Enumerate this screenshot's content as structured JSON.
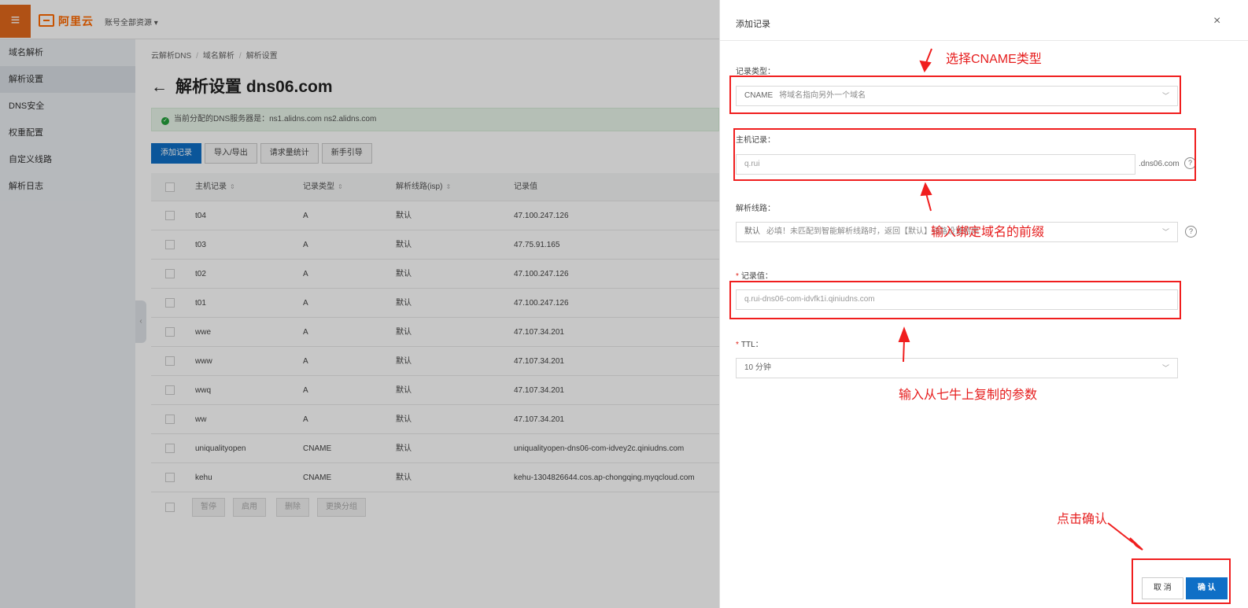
{
  "topbar": {
    "menu_icon": "≡",
    "logo_text": "阿里云",
    "account_scope": "账号全部资源 ▾"
  },
  "sidebar": {
    "items": [
      {
        "label": "域名解析",
        "active": false
      },
      {
        "label": "解析设置",
        "active": true
      },
      {
        "label": "DNS安全",
        "active": false
      },
      {
        "label": "权重配置",
        "active": false
      },
      {
        "label": "自定义线路",
        "active": false
      },
      {
        "label": "解析日志",
        "active": false
      }
    ],
    "collapse_icon": "‹"
  },
  "breadcrumb": {
    "items": [
      "云解析DNS",
      "域名解析",
      "解析设置"
    ],
    "separator": "/"
  },
  "page": {
    "back_icon": "←",
    "title": "解析设置 dns06.com",
    "notice": "当前分配的DNS服务器是：ns1.alidns.com ns2.alidns.com",
    "notice_icon": "✓"
  },
  "toolbar": {
    "buttons": [
      "添加记录",
      "导入/导出",
      "请求量统计",
      "新手引导"
    ]
  },
  "table": {
    "headers": [
      "主机记录",
      "记录类型",
      "解析线路(isp)",
      "记录值"
    ],
    "sort_icon": "⇕",
    "rows": [
      {
        "host": "t04",
        "type": "A",
        "line": "默认",
        "value": "47.100.247.126"
      },
      {
        "host": "t03",
        "type": "A",
        "line": "默认",
        "value": "47.75.91.165"
      },
      {
        "host": "t02",
        "type": "A",
        "line": "默认",
        "value": "47.100.247.126"
      },
      {
        "host": "t01",
        "type": "A",
        "line": "默认",
        "value": "47.100.247.126"
      },
      {
        "host": "wwe",
        "type": "A",
        "line": "默认",
        "value": "47.107.34.201"
      },
      {
        "host": "www",
        "type": "A",
        "line": "默认",
        "value": "47.107.34.201"
      },
      {
        "host": "wwq",
        "type": "A",
        "line": "默认",
        "value": "47.107.34.201"
      },
      {
        "host": "ww",
        "type": "A",
        "line": "默认",
        "value": "47.107.34.201"
      },
      {
        "host": "uniqualityopen",
        "type": "CNAME",
        "line": "默认",
        "value": "uniqualityopen-dns06-com-idvey2c.qiniudns.com"
      },
      {
        "host": "kehu",
        "type": "CNAME",
        "line": "默认",
        "value": "kehu-1304826644.cos.ap-chongqing.myqcloud.com"
      }
    ],
    "bulk_buttons": [
      "暂停",
      "启用",
      "删除",
      "更换分组"
    ]
  },
  "drawer": {
    "title": "添加记录",
    "close_icon": "×",
    "record_type": {
      "label": "记录类型：",
      "value": "CNAME",
      "hint": "将域名指向另外一个域名"
    },
    "host": {
      "label": "主机记录：",
      "value": "q.rui",
      "suffix": ".dns06.com"
    },
    "line": {
      "label": "解析线路：",
      "value": "默认",
      "hint": "必填！未匹配到智能解析线路时，返回【默认】线路设置结果"
    },
    "record_value": {
      "required_mark": "*",
      "label": "记录值：",
      "value": "q.rui-dns06-com-idvfk1i.qiniudns.com"
    },
    "ttl": {
      "required_mark": "*",
      "label": "TTL：",
      "value": "10 分钟"
    },
    "help_icon": "?",
    "chevron_icon": "﹀",
    "cancel_label": "取 消",
    "confirm_label": "确 认"
  },
  "annotations": {
    "select_type": "选择CNAME类型",
    "input_prefix": "输入绑定域名的前缀",
    "input_param": "输入从七牛上复制的参数",
    "click_confirm": "点击确认",
    "color": "#f01e1e"
  }
}
